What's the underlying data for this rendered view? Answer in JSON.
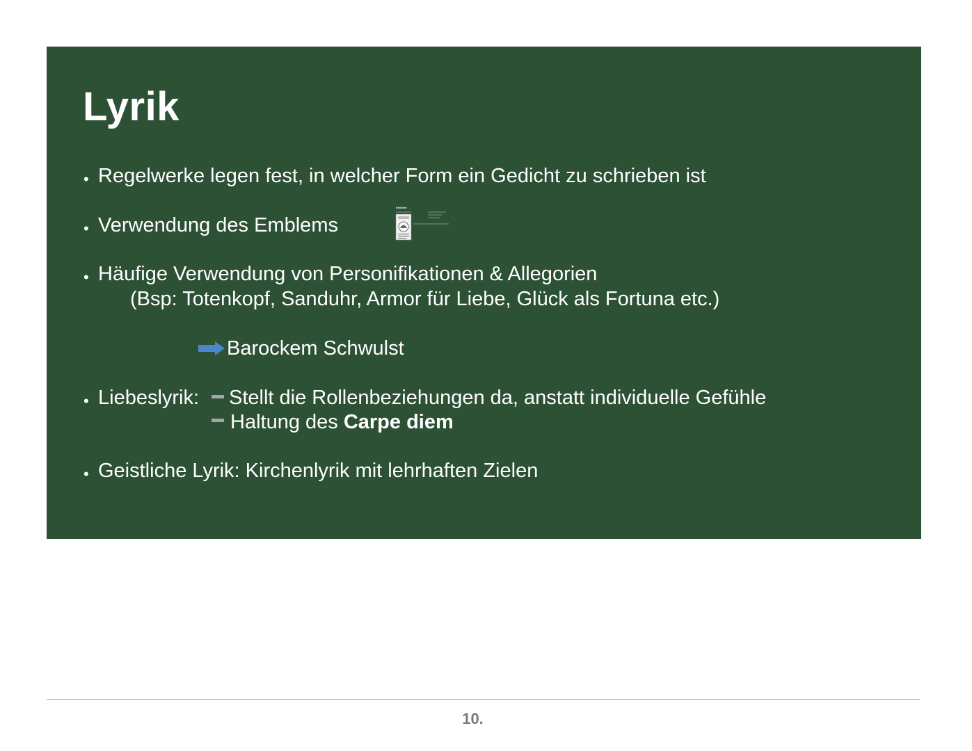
{
  "slide": {
    "title": "Lyrik",
    "bullets": {
      "regelwerke": "Regelwerke legen fest, in welcher Form ein Gedicht zu schrieben ist",
      "emblem": "Verwendung des Emblems",
      "haeufige": "Häufige Verwendung von Personifikationen & Allegorien",
      "haeufige_example": "(Bsp: Totenkopf, Sanduhr, Armor für Liebe, Glück als Fortuna etc.)",
      "schwulst": "Barockem Schwulst",
      "liebeslyrik_label": "Liebeslyrik:",
      "liebeslyrik_point1": "Stellt die Rollenbeziehungen da, anstatt individuelle Gefühle",
      "liebeslyrik_point2_prefix": "Haltung des ",
      "liebeslyrik_point2_bold": "Carpe diem",
      "geistliche": "Geistliche Lyrik: Kirchenlyrik mit lehrhaften Zielen"
    },
    "emblem_thumbnail": {
      "heading": "Emblem"
    },
    "colors": {
      "background": "#2d5135",
      "text": "#ffffff",
      "arrow": "#4a86c8",
      "dash": "#a6a6a6"
    }
  },
  "footer": {
    "page_number": "10."
  }
}
